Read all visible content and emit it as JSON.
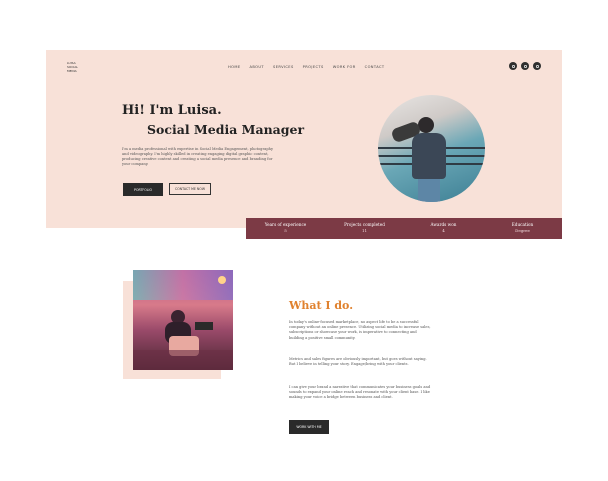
{
  "logo": {
    "line1": "LUISA",
    "line2": "SOCIAL",
    "line3": "MEDIA"
  },
  "nav": [
    "HOME",
    "ABOUT",
    "SERVICES",
    "PROJECTS",
    "WORK FOR",
    "CONTACT"
  ],
  "socials": [
    "instagram-icon",
    "pinterest-icon",
    "linkedin-icon"
  ],
  "hero": {
    "greeting": "Hi! I'm Luisa.",
    "role": "Social Media Manager",
    "intro": "I'm a media professional with expertise in Social Media Engagement, photography and videography. I'm highly skilled in creating engaging digital graphic content, producing creative content and creating a social media presence and branding for your company.",
    "primary_button": "PORTFOLIO",
    "secondary_button": "CONTACT ME NOW"
  },
  "stats": [
    {
      "label": "Years of experience",
      "value": "5"
    },
    {
      "label": "Projects completed",
      "value": "11"
    },
    {
      "label": "Awards won",
      "value": "4"
    },
    {
      "label": "Education",
      "value": "Degree"
    }
  ],
  "what": {
    "title": "What I do.",
    "p1": "In today's online-focused marketplace, no aspect life to be a successful company without an online presence. Utilizing social media to increase sales, subscriptions or showcase your work, is imperative to connecting and building a positive small community.",
    "p2": "Metrics and sales figures are obviously important, but goes without saying. But I believe in telling your story. Engage/bring with your clients.",
    "p3": "I can give your brand a narrative that communicates your business goals and sounds to expand your online reach and resonate with your client base. I like making your voice a bridge between business and client.",
    "button": "WORK WITH ME"
  }
}
